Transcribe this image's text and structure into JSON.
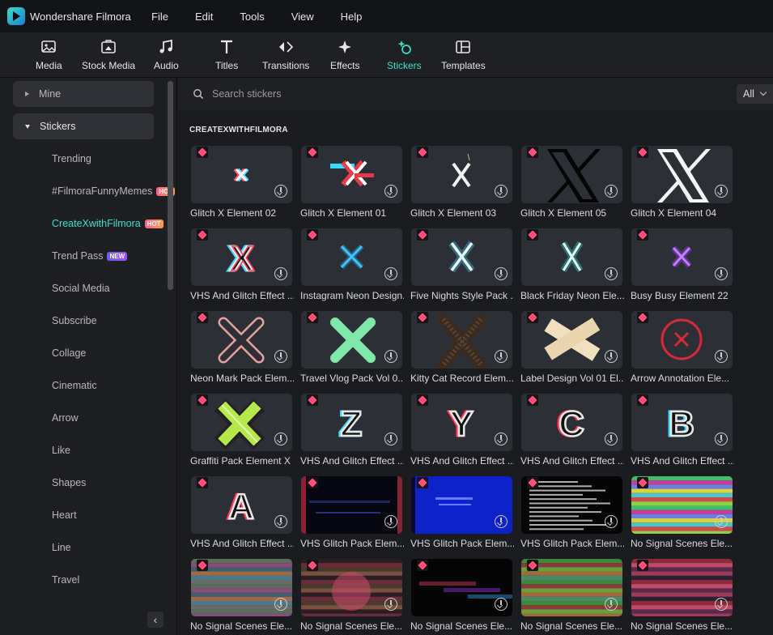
{
  "app": {
    "title": "Wondershare Filmora"
  },
  "menu": [
    "File",
    "Edit",
    "Tools",
    "View",
    "Help"
  ],
  "toolbar": [
    {
      "label": "Media",
      "icon": "media-icon"
    },
    {
      "label": "Stock Media",
      "icon": "stock-media-icon"
    },
    {
      "label": "Audio",
      "icon": "music-note-icon"
    },
    {
      "label": "Titles",
      "icon": "title-t-icon"
    },
    {
      "label": "Transitions",
      "icon": "transitions-icon"
    },
    {
      "label": "Effects",
      "icon": "effects-sparkle-icon"
    },
    {
      "label": "Stickers",
      "icon": "stickers-icon",
      "active": true
    },
    {
      "label": "Templates",
      "icon": "templates-icon"
    }
  ],
  "sidebar": {
    "categories": [
      {
        "label": "Mine",
        "expanded": false
      },
      {
        "label": "Stickers",
        "expanded": true
      }
    ],
    "items": [
      {
        "label": "Trending"
      },
      {
        "label": "#FilmoraFunnyMemes",
        "badge": "HOT"
      },
      {
        "label": "CreateXwithFilmora",
        "badge": "HOT",
        "active": true
      },
      {
        "label": "Trend Pass",
        "badge": "NEW"
      },
      {
        "label": "Social Media"
      },
      {
        "label": "Subscribe"
      },
      {
        "label": "Collage"
      },
      {
        "label": "Cinematic"
      },
      {
        "label": "Arrow"
      },
      {
        "label": "Like"
      },
      {
        "label": "Shapes"
      },
      {
        "label": "Heart"
      },
      {
        "label": "Line"
      },
      {
        "label": "Travel"
      }
    ],
    "collapse_label": "‹"
  },
  "search": {
    "placeholder": "Search stickers",
    "value": ""
  },
  "filter": {
    "selected": "All"
  },
  "section_title": "CREATEXWITHFILMORA",
  "stickers": [
    {
      "name": "Glitch X Element 02",
      "art": "glitch-x-small"
    },
    {
      "name": "Glitch X Element 01",
      "art": "glitch-x-red"
    },
    {
      "name": "Glitch X Element 03",
      "art": "x-white-small"
    },
    {
      "name": "Glitch X Element 05",
      "art": "x-logo-black"
    },
    {
      "name": "Glitch X Element 04",
      "art": "x-logo-white"
    },
    {
      "name": "VHS And Glitch Effect ...",
      "art": "vhs-x"
    },
    {
      "name": "Instagram Neon Design...",
      "art": "neon-x-blue"
    },
    {
      "name": "Five Nights Style Pack ...",
      "art": "neon-x-cyan"
    },
    {
      "name": "Black Friday Neon Ele...",
      "art": "neon-x-teal"
    },
    {
      "name": "Busy Busy Element 22",
      "art": "neon-x-purple"
    },
    {
      "name": "Neon Mark Pack Elem...",
      "art": "neon-x-pink"
    },
    {
      "name": "Travel Vlog Pack Vol 0...",
      "art": "green-x"
    },
    {
      "name": "Kitty Cat Record Elem...",
      "art": "fur-x"
    },
    {
      "name": "Label Design Vol 01 El...",
      "art": "tape-x"
    },
    {
      "name": "Arrow Annotation Ele...",
      "art": "circle-x-red"
    },
    {
      "name": "Graffiti Pack Element X",
      "art": "graffiti-x"
    },
    {
      "name": "VHS And Glitch Effect ...",
      "art": "vhs-z"
    },
    {
      "name": "VHS And Glitch Effect ...",
      "art": "vhs-y"
    },
    {
      "name": "VHS And Glitch Effect ...",
      "art": "vhs-c"
    },
    {
      "name": "VHS And Glitch Effect ...",
      "art": "vhs-b"
    },
    {
      "name": "VHS And Glitch Effect ...",
      "art": "vhs-a"
    },
    {
      "name": "VHS Glitch Pack Elem...",
      "art": "vhs-dark"
    },
    {
      "name": "VHS Glitch Pack Elem...",
      "art": "vhs-blue"
    },
    {
      "name": "VHS Glitch Pack Elem...",
      "art": "vhs-text"
    },
    {
      "name": "No Signal Scenes Ele...",
      "art": "noise-color"
    },
    {
      "name": "No Signal Scenes Ele...",
      "art": "noise-stripe"
    },
    {
      "name": "No Signal Scenes Ele...",
      "art": "noise-circle"
    },
    {
      "name": "No Signal Scenes Ele...",
      "art": "noise-dark"
    },
    {
      "name": "No Signal Scenes Ele...",
      "art": "noise-green"
    },
    {
      "name": "No Signal Scenes Ele...",
      "art": "noise-red"
    }
  ],
  "colors": {
    "accent": "#3fe0c5",
    "premium_gem": "#ff4f7a",
    "background": "#1b1c20",
    "panel": "#1e1f23"
  }
}
